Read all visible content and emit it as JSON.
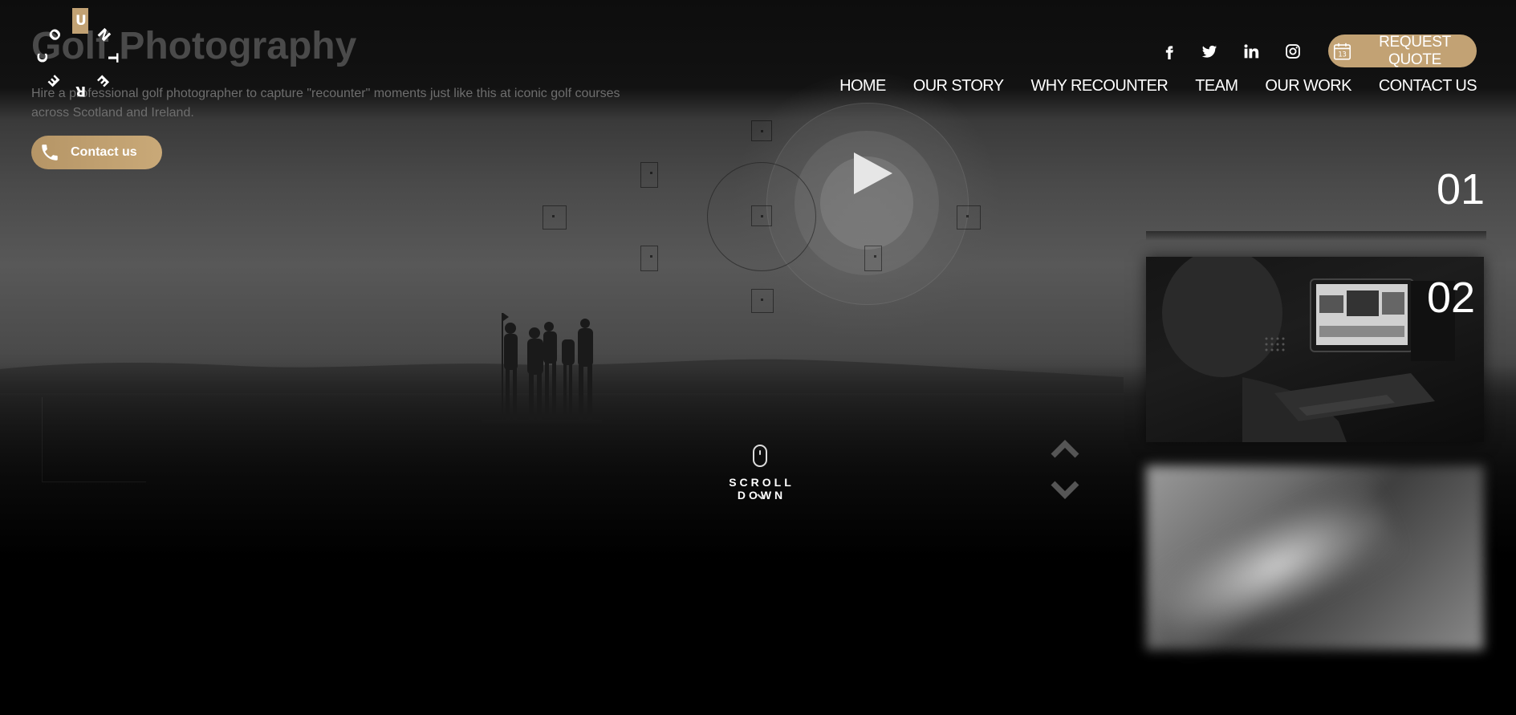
{
  "hero": {
    "title": "Golf Photography",
    "subtitle": "Hire a professional golf photographer to capture \"recounter\" moments just like this at iconic golf courses across Scotland and Ireland.",
    "contact_button": "Contact us"
  },
  "logo": {
    "letters": [
      "U",
      "N",
      "T",
      "E",
      "R",
      "E",
      "C",
      "O"
    ]
  },
  "social": [
    "facebook-icon",
    "twitter-icon",
    "linkedin-icon",
    "instagram-icon"
  ],
  "quote_button": {
    "label": "REQUEST QUOTE",
    "icon_text": "13"
  },
  "nav": {
    "items": [
      "HOME",
      "OUR STORY",
      "WHY RECOUNTER",
      "TEAM",
      "OUR WORK",
      "CONTACT US"
    ]
  },
  "scroll": {
    "label": "SCROLL DOWN"
  },
  "slides": {
    "first_number": "01",
    "second_number": "02"
  },
  "colors": {
    "accent": "#c2a274",
    "background": "#000000"
  }
}
